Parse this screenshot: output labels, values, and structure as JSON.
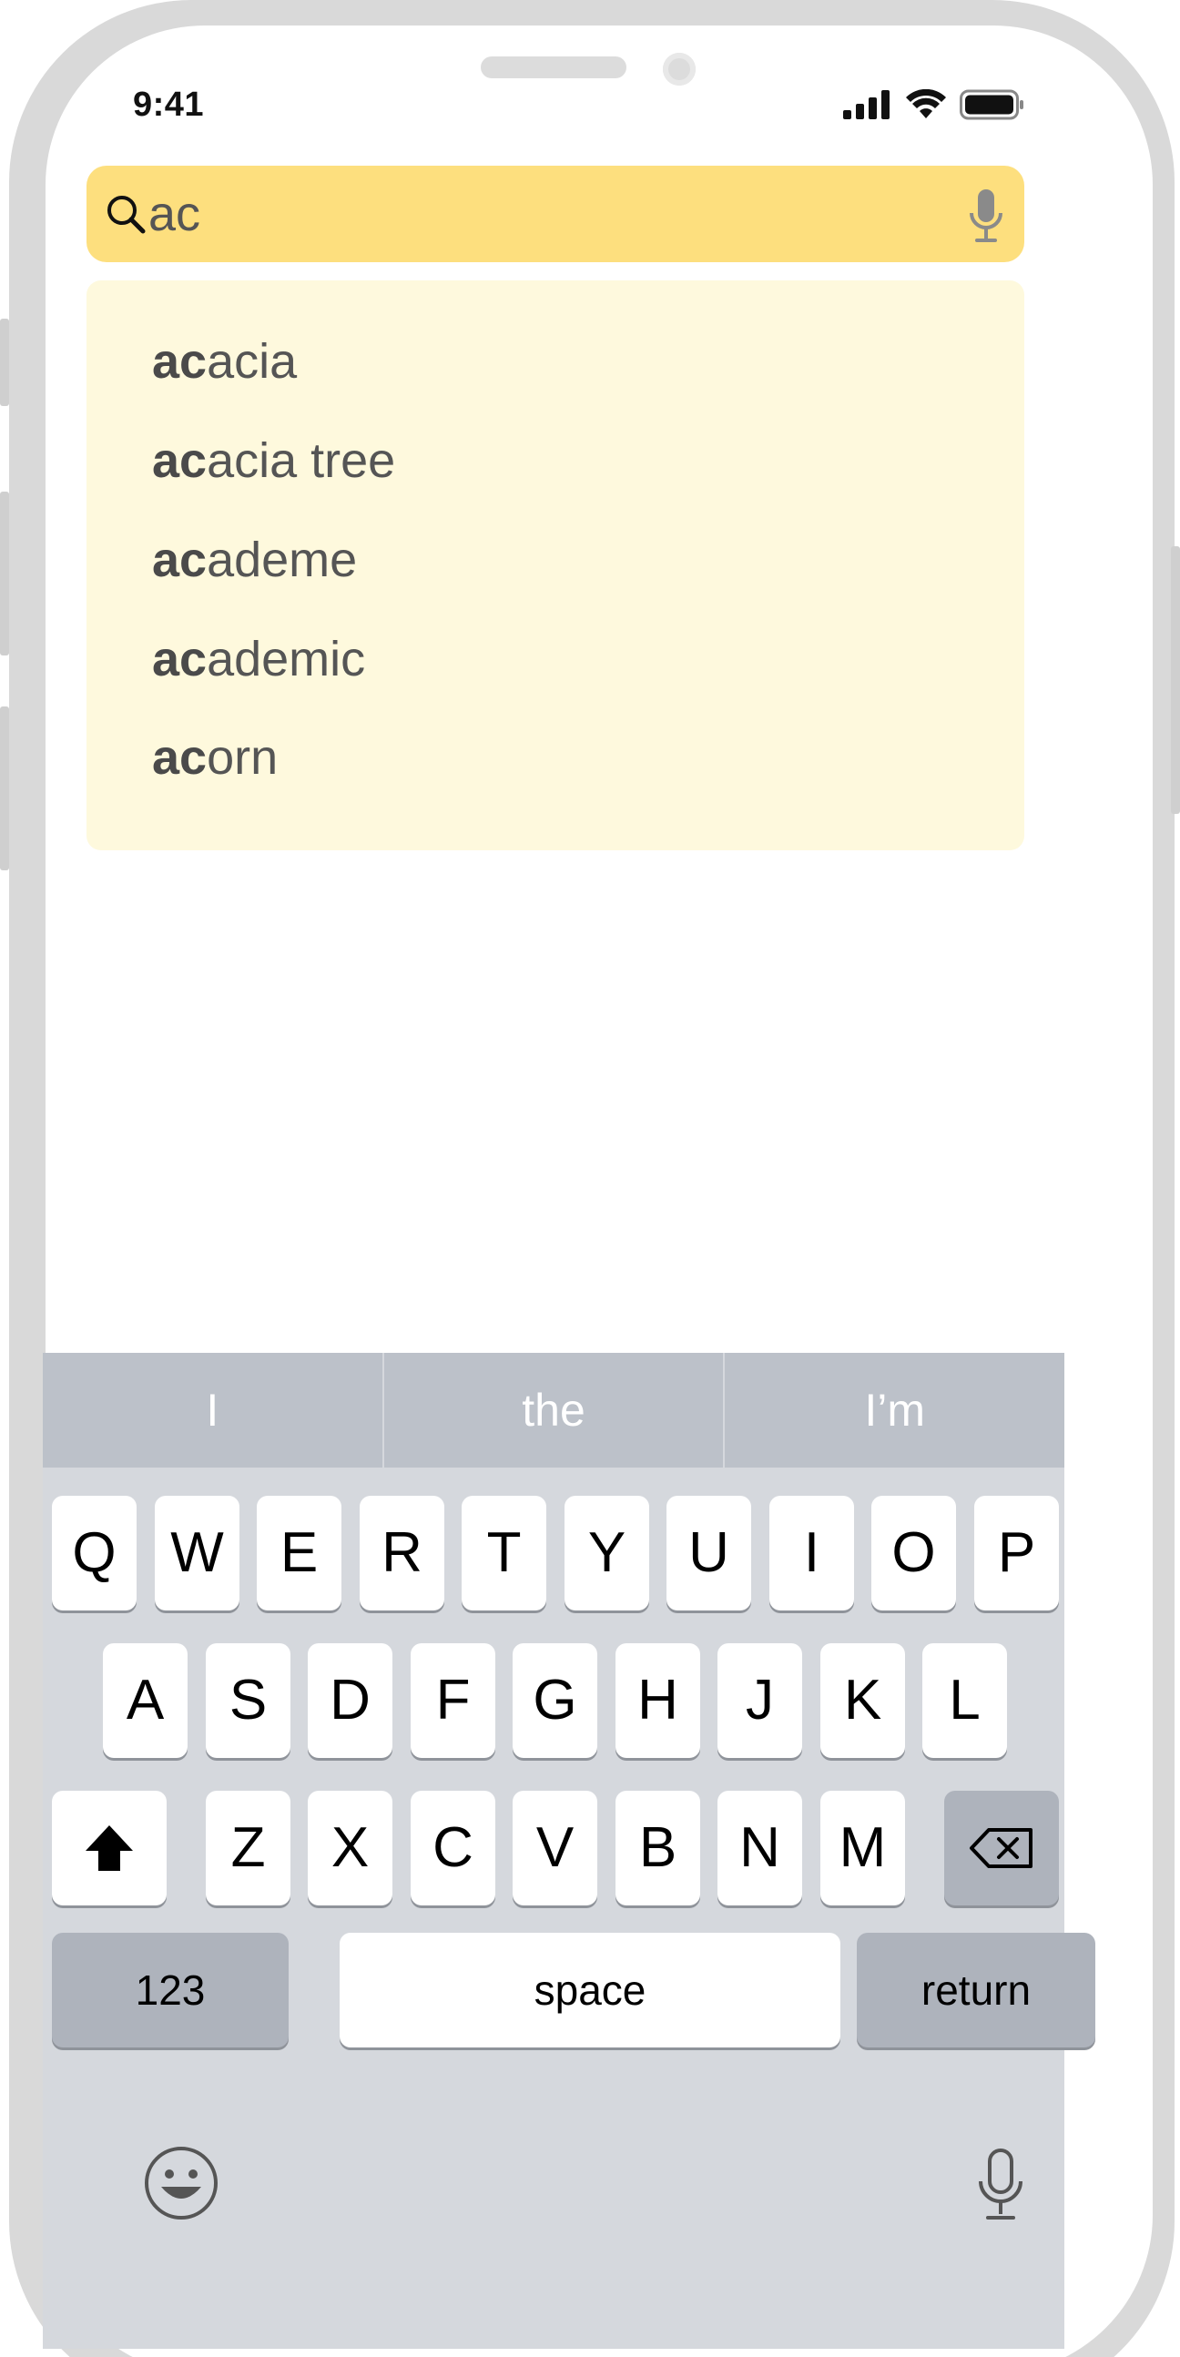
{
  "status_bar": {
    "time": "9:41"
  },
  "search": {
    "query": "ac",
    "placeholder": ""
  },
  "suggestions": [
    {
      "prefix": "ac",
      "rest": "acia"
    },
    {
      "prefix": "ac",
      "rest": "acia tree"
    },
    {
      "prefix": "ac",
      "rest": "ademe"
    },
    {
      "prefix": "ac",
      "rest": "ademic"
    },
    {
      "prefix": "ac",
      "rest": "orn"
    }
  ],
  "predictions": [
    "I",
    "the",
    "I’m"
  ],
  "keyboard": {
    "row1": [
      "Q",
      "W",
      "E",
      "R",
      "T",
      "Y",
      "U",
      "I",
      "O",
      "P"
    ],
    "row2": [
      "A",
      "S",
      "D",
      "F",
      "G",
      "H",
      "J",
      "K",
      "L"
    ],
    "row3": [
      "Z",
      "X",
      "C",
      "V",
      "B",
      "N",
      "M"
    ],
    "numbers_label": "123",
    "space_label": "space",
    "return_label": "return"
  },
  "colors": {
    "search_bg": "#fddf7e",
    "suggestions_bg": "#fef9dd",
    "keyboard_bg": "#d5d8dd"
  }
}
